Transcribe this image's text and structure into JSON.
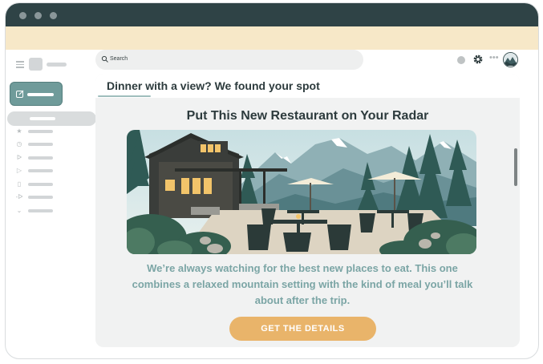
{
  "toolbar": {
    "search_placeholder": "Search"
  },
  "email": {
    "subject": "Dinner with a view? We found your spot",
    "headline": "Put This New Restaurant on Your Radar",
    "body": "We’re always watching for the best new places to eat. This one combines a relaxed mountain setting with the kind of meal you’ll talk about after the trip.",
    "cta_label": "GET THE DETAILS",
    "hero_image": "mountain-restaurant-patio-illustration"
  },
  "icons": {
    "nav": [
      "star-icon",
      "clock-icon",
      "send-icon",
      "play-icon",
      "file-icon",
      "label-icon",
      "chevron-down-icon"
    ]
  },
  "colors": {
    "titlebar": "#2f4346",
    "banner": "#f7e8c8",
    "accent": "#6f9b9a",
    "cta": "#e9b46a",
    "body_text": "#7ba5a5"
  }
}
